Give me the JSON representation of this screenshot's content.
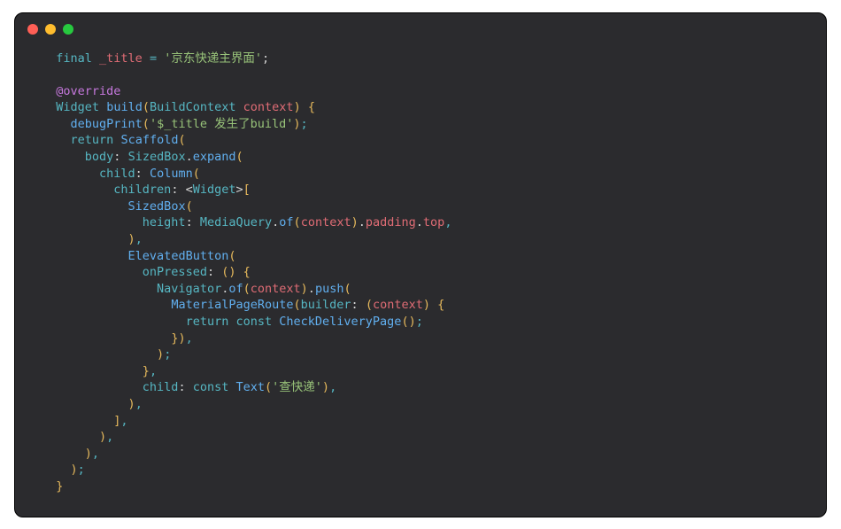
{
  "code": {
    "lines": [
      [
        {
          "t": "  ",
          "c": "punc"
        },
        {
          "t": "final",
          "c": "kw"
        },
        {
          "t": " ",
          "c": "punc"
        },
        {
          "t": "_title",
          "c": "var"
        },
        {
          "t": " ",
          "c": "punc"
        },
        {
          "t": "=",
          "c": "kw"
        },
        {
          "t": " ",
          "c": "punc"
        },
        {
          "t": "'京东快递主界面'",
          "c": "str"
        },
        {
          "t": ";",
          "c": "punc"
        }
      ],
      [],
      [
        {
          "t": "  ",
          "c": "punc"
        },
        {
          "t": "@override",
          "c": "kw2"
        }
      ],
      [
        {
          "t": "  ",
          "c": "punc"
        },
        {
          "t": "Widget",
          "c": "type"
        },
        {
          "t": " ",
          "c": "punc"
        },
        {
          "t": "build",
          "c": "fn"
        },
        {
          "t": "(",
          "c": "paren"
        },
        {
          "t": "BuildContext",
          "c": "type"
        },
        {
          "t": " ",
          "c": "punc"
        },
        {
          "t": "context",
          "c": "var"
        },
        {
          "t": ")",
          "c": "paren"
        },
        {
          "t": " ",
          "c": "punc"
        },
        {
          "t": "{",
          "c": "paren"
        }
      ],
      [
        {
          "t": "    ",
          "c": "punc"
        },
        {
          "t": "debugPrint",
          "c": "fn"
        },
        {
          "t": "(",
          "c": "paren"
        },
        {
          "t": "'$_title 发生了build'",
          "c": "str"
        },
        {
          "t": ")",
          "c": "paren"
        },
        {
          "t": ";",
          "c": "kw"
        }
      ],
      [
        {
          "t": "    ",
          "c": "punc"
        },
        {
          "t": "return",
          "c": "kw"
        },
        {
          "t": " ",
          "c": "punc"
        },
        {
          "t": "Scaffold",
          "c": "fn"
        },
        {
          "t": "(",
          "c": "paren"
        }
      ],
      [
        {
          "t": "      ",
          "c": "punc"
        },
        {
          "t": "body",
          "c": "prop"
        },
        {
          "t": ":",
          "c": "punc"
        },
        {
          "t": " ",
          "c": "punc"
        },
        {
          "t": "SizedBox",
          "c": "type"
        },
        {
          "t": ".",
          "c": "dot2"
        },
        {
          "t": "expand",
          "c": "fn"
        },
        {
          "t": "(",
          "c": "paren"
        }
      ],
      [
        {
          "t": "        ",
          "c": "punc"
        },
        {
          "t": "child",
          "c": "prop"
        },
        {
          "t": ":",
          "c": "punc"
        },
        {
          "t": " ",
          "c": "punc"
        },
        {
          "t": "Column",
          "c": "fn"
        },
        {
          "t": "(",
          "c": "paren"
        }
      ],
      [
        {
          "t": "          ",
          "c": "punc"
        },
        {
          "t": "children",
          "c": "prop"
        },
        {
          "t": ":",
          "c": "punc"
        },
        {
          "t": " ",
          "c": "punc"
        },
        {
          "t": "<",
          "c": "punc"
        },
        {
          "t": "Widget",
          "c": "type"
        },
        {
          "t": ">",
          "c": "punc"
        },
        {
          "t": "[",
          "c": "paren"
        }
      ],
      [
        {
          "t": "            ",
          "c": "punc"
        },
        {
          "t": "SizedBox",
          "c": "fn"
        },
        {
          "t": "(",
          "c": "paren"
        }
      ],
      [
        {
          "t": "              ",
          "c": "punc"
        },
        {
          "t": "height",
          "c": "prop"
        },
        {
          "t": ":",
          "c": "punc"
        },
        {
          "t": " ",
          "c": "punc"
        },
        {
          "t": "MediaQuery",
          "c": "type"
        },
        {
          "t": ".",
          "c": "dot2"
        },
        {
          "t": "of",
          "c": "fn"
        },
        {
          "t": "(",
          "c": "paren"
        },
        {
          "t": "context",
          "c": "var"
        },
        {
          "t": ")",
          "c": "paren"
        },
        {
          "t": ".",
          "c": "dot2"
        },
        {
          "t": "padding",
          "c": "var"
        },
        {
          "t": ".",
          "c": "dot2"
        },
        {
          "t": "top",
          "c": "var"
        },
        {
          "t": ",",
          "c": "kw"
        }
      ],
      [
        {
          "t": "            ",
          "c": "punc"
        },
        {
          "t": ")",
          "c": "paren"
        },
        {
          "t": ",",
          "c": "kw"
        }
      ],
      [
        {
          "t": "            ",
          "c": "punc"
        },
        {
          "t": "ElevatedButton",
          "c": "fn"
        },
        {
          "t": "(",
          "c": "paren"
        }
      ],
      [
        {
          "t": "              ",
          "c": "punc"
        },
        {
          "t": "onPressed",
          "c": "prop"
        },
        {
          "t": ":",
          "c": "punc"
        },
        {
          "t": " ",
          "c": "punc"
        },
        {
          "t": "()",
          "c": "paren"
        },
        {
          "t": " ",
          "c": "punc"
        },
        {
          "t": "{",
          "c": "paren"
        }
      ],
      [
        {
          "t": "                ",
          "c": "punc"
        },
        {
          "t": "Navigator",
          "c": "type"
        },
        {
          "t": ".",
          "c": "dot2"
        },
        {
          "t": "of",
          "c": "fn"
        },
        {
          "t": "(",
          "c": "paren"
        },
        {
          "t": "context",
          "c": "var"
        },
        {
          "t": ")",
          "c": "paren"
        },
        {
          "t": ".",
          "c": "dot2"
        },
        {
          "t": "push",
          "c": "fn"
        },
        {
          "t": "(",
          "c": "paren"
        }
      ],
      [
        {
          "t": "                  ",
          "c": "punc"
        },
        {
          "t": "MaterialPageRoute",
          "c": "fn"
        },
        {
          "t": "(",
          "c": "paren"
        },
        {
          "t": "builder",
          "c": "prop"
        },
        {
          "t": ":",
          "c": "punc"
        },
        {
          "t": " ",
          "c": "punc"
        },
        {
          "t": "(",
          "c": "paren"
        },
        {
          "t": "context",
          "c": "var"
        },
        {
          "t": ")",
          "c": "paren"
        },
        {
          "t": " ",
          "c": "punc"
        },
        {
          "t": "{",
          "c": "paren"
        }
      ],
      [
        {
          "t": "                    ",
          "c": "punc"
        },
        {
          "t": "return",
          "c": "kw"
        },
        {
          "t": " ",
          "c": "punc"
        },
        {
          "t": "const",
          "c": "kw"
        },
        {
          "t": " ",
          "c": "punc"
        },
        {
          "t": "CheckDeliveryPage",
          "c": "fn"
        },
        {
          "t": "()",
          "c": "paren"
        },
        {
          "t": ";",
          "c": "kw"
        }
      ],
      [
        {
          "t": "                  ",
          "c": "punc"
        },
        {
          "t": "})",
          "c": "paren"
        },
        {
          "t": ",",
          "c": "kw"
        }
      ],
      [
        {
          "t": "                ",
          "c": "punc"
        },
        {
          "t": ")",
          "c": "paren"
        },
        {
          "t": ";",
          "c": "kw"
        }
      ],
      [
        {
          "t": "              ",
          "c": "punc"
        },
        {
          "t": "}",
          "c": "paren"
        },
        {
          "t": ",",
          "c": "kw"
        }
      ],
      [
        {
          "t": "              ",
          "c": "punc"
        },
        {
          "t": "child",
          "c": "prop"
        },
        {
          "t": ":",
          "c": "punc"
        },
        {
          "t": " ",
          "c": "punc"
        },
        {
          "t": "const",
          "c": "kw"
        },
        {
          "t": " ",
          "c": "punc"
        },
        {
          "t": "Text",
          "c": "fn"
        },
        {
          "t": "(",
          "c": "paren"
        },
        {
          "t": "'查快递'",
          "c": "str"
        },
        {
          "t": ")",
          "c": "paren"
        },
        {
          "t": ",",
          "c": "kw"
        }
      ],
      [
        {
          "t": "            ",
          "c": "punc"
        },
        {
          "t": ")",
          "c": "paren"
        },
        {
          "t": ",",
          "c": "kw"
        }
      ],
      [
        {
          "t": "          ",
          "c": "punc"
        },
        {
          "t": "]",
          "c": "paren"
        },
        {
          "t": ",",
          "c": "kw"
        }
      ],
      [
        {
          "t": "        ",
          "c": "punc"
        },
        {
          "t": ")",
          "c": "paren"
        },
        {
          "t": ",",
          "c": "kw"
        }
      ],
      [
        {
          "t": "      ",
          "c": "punc"
        },
        {
          "t": ")",
          "c": "paren"
        },
        {
          "t": ",",
          "c": "kw"
        }
      ],
      [
        {
          "t": "    ",
          "c": "punc"
        },
        {
          "t": ")",
          "c": "paren"
        },
        {
          "t": ";",
          "c": "kw"
        }
      ],
      [
        {
          "t": "  ",
          "c": "punc"
        },
        {
          "t": "}",
          "c": "paren"
        }
      ]
    ]
  }
}
